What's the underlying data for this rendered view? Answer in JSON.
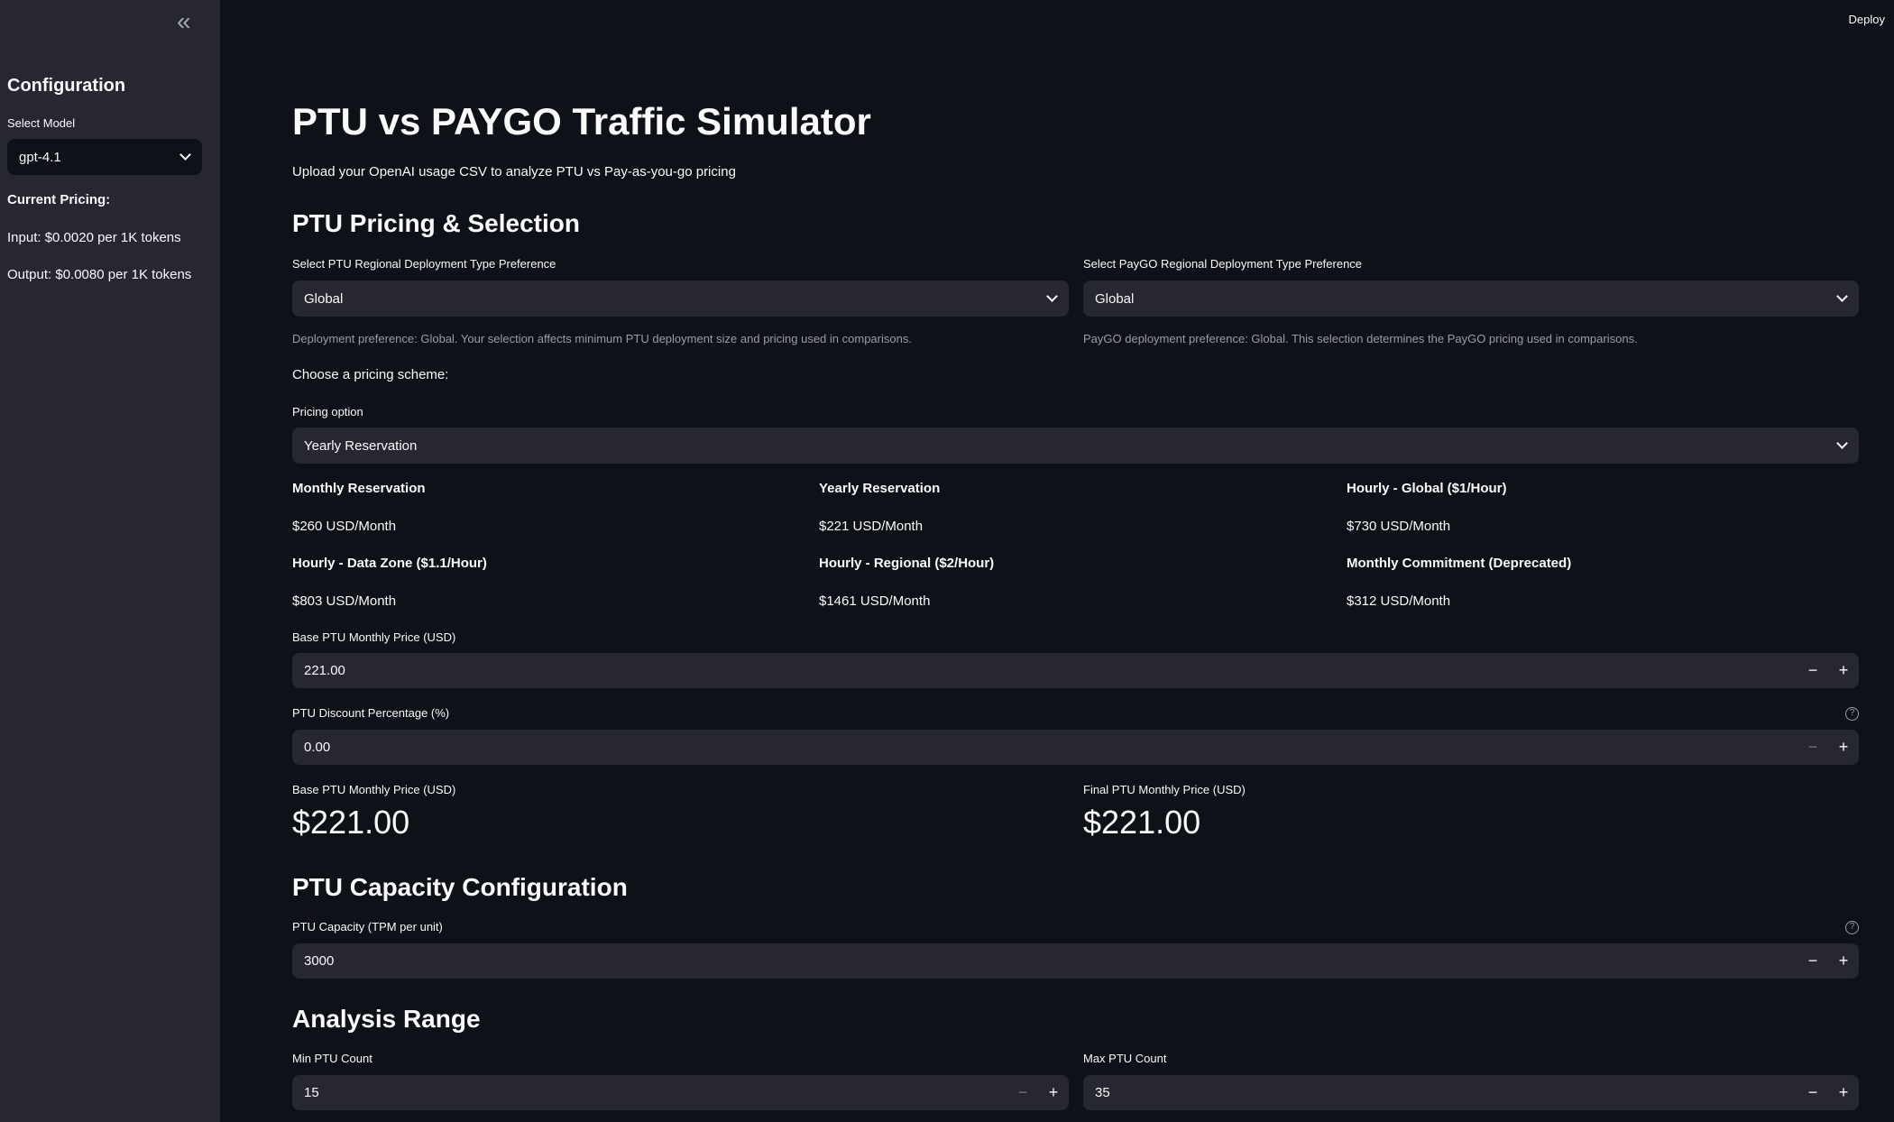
{
  "sidebar": {
    "collapse_icon": "double-chevron-left",
    "title": "Configuration",
    "model_label": "Select Model",
    "model_value": "gpt-4.1",
    "pricing_heading": "Current Pricing:",
    "input_price": "Input: $0.0020 per 1K tokens",
    "output_price": "Output: $0.0080 per 1K tokens"
  },
  "header": {
    "deploy": "Deploy"
  },
  "main": {
    "title": "PTU vs PAYGO Traffic Simulator",
    "subtitle": "Upload your OpenAI usage CSV to analyze PTU vs Pay-as-you-go pricing",
    "section1": "PTU Pricing & Selection",
    "ptu_region_label": "Select PTU Regional Deployment Type Preference",
    "ptu_region_value": "Global",
    "ptu_region_caption": "Deployment preference: Global. Your selection affects minimum PTU deployment size and pricing used in comparisons.",
    "paygo_region_label": "Select PayGO Regional Deployment Type Preference",
    "paygo_region_value": "Global",
    "paygo_region_caption": "PayGO deployment preference: Global. This selection determines the PayGO pricing used in comparisons.",
    "choose_scheme": "Choose a pricing scheme:",
    "pricing_option_label": "Pricing option",
    "pricing_option_value": "Yearly Reservation",
    "schemes": [
      {
        "name": "Monthly Reservation",
        "price": "$260 USD/Month"
      },
      {
        "name": "Yearly Reservation",
        "price": "$221 USD/Month"
      },
      {
        "name": "Hourly - Global ($1/Hour)",
        "price": "$730 USD/Month"
      },
      {
        "name": "Hourly - Data Zone ($1.1/Hour)",
        "price": "$803 USD/Month"
      },
      {
        "name": "Hourly - Regional ($2/Hour)",
        "price": "$1461 USD/Month"
      },
      {
        "name": "Monthly Commitment (Deprecated)",
        "price": "$312 USD/Month"
      }
    ],
    "base_price_label": "Base PTU Monthly Price (USD)",
    "base_price_value": "221.00",
    "discount_label": "PTU Discount Percentage (%)",
    "discount_value": "0.00",
    "metric_base_label": "Base PTU Monthly Price (USD)",
    "metric_base_value": "$221.00",
    "metric_final_label": "Final PTU Monthly Price (USD)",
    "metric_final_value": "$221.00",
    "section2": "PTU Capacity Configuration",
    "capacity_label": "PTU Capacity (TPM per unit)",
    "capacity_value": "3000",
    "section3": "Analysis Range",
    "min_label": "Min PTU Count",
    "min_value": "15",
    "max_label": "Max PTU Count",
    "max_value": "35",
    "minus": "−",
    "plus": "+",
    "help": "?"
  }
}
